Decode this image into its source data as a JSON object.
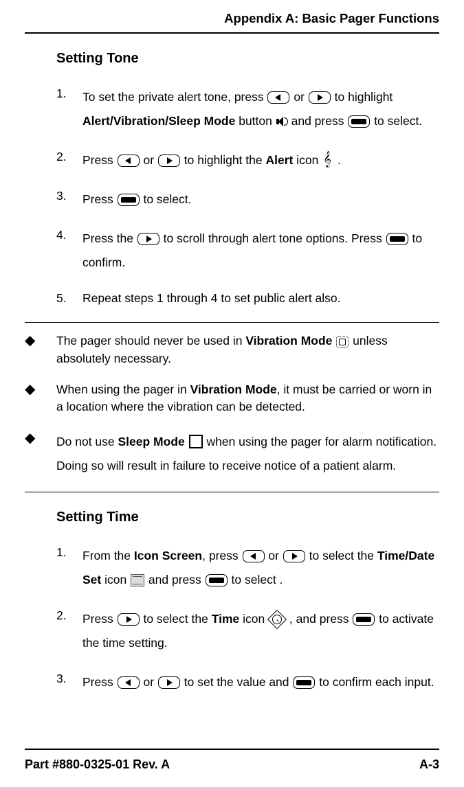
{
  "header": {
    "title": "Appendix A: Basic Pager Functions"
  },
  "section1": {
    "title": "Setting Tone",
    "step1a": "To set the private alert tone, press ",
    "step1b": " or ",
    "step1c": " to highlight ",
    "step1d": "Alert/Vibration/Sleep Mode",
    "step1e": " button ",
    "step1f": " and press ",
    "step1g": " to select.",
    "step2a": "Press ",
    "step2b": " or ",
    "step2c": " to highlight the ",
    "step2d": "Alert",
    "step2e": " icon ",
    "step2f": " .",
    "step3a": "Press ",
    "step3b": " to select.",
    "step4a": "Press the ",
    "step4b": " to scroll through alert tone options. Press ",
    "step4c": " to confirm.",
    "step5": "Repeat steps 1 through 4 to set public alert also."
  },
  "notes": {
    "n1a": "The pager should never be used in ",
    "n1b": "Vibration Mode",
    "n1c": " unless absolutely necessary.",
    "n2a": "When using the pager in ",
    "n2b": "Vibration Mode",
    "n2c": ", it must be carried or worn in a location where the vibration can be detected.",
    "n3a": "Do not use ",
    "n3b": "Sleep Mode",
    "n3c": " when using the pager for alarm notification. Doing so will result in failure to receive notice of a patient alarm."
  },
  "section2": {
    "title": "Setting Time",
    "s1a": "From the ",
    "s1b": "Icon Screen",
    "s1c": ", press ",
    "s1d": " or ",
    "s1e": " to select the ",
    "s1f": "Time/Date Set",
    "s1g": " icon ",
    "s1h": " and press ",
    "s1i": " to select .",
    "s2a": "Press ",
    "s2b": " to select the ",
    "s2c": "Time",
    "s2d": " icon ",
    "s2e": " , and press ",
    "s2f": " to activate the time setting.",
    "s3a": "Press ",
    "s3b": " or ",
    "s3c": " to set the value and ",
    "s3d": " to confirm each input."
  },
  "footer": {
    "left": "Part #880-0325-01 Rev. A",
    "right": "A-3"
  }
}
